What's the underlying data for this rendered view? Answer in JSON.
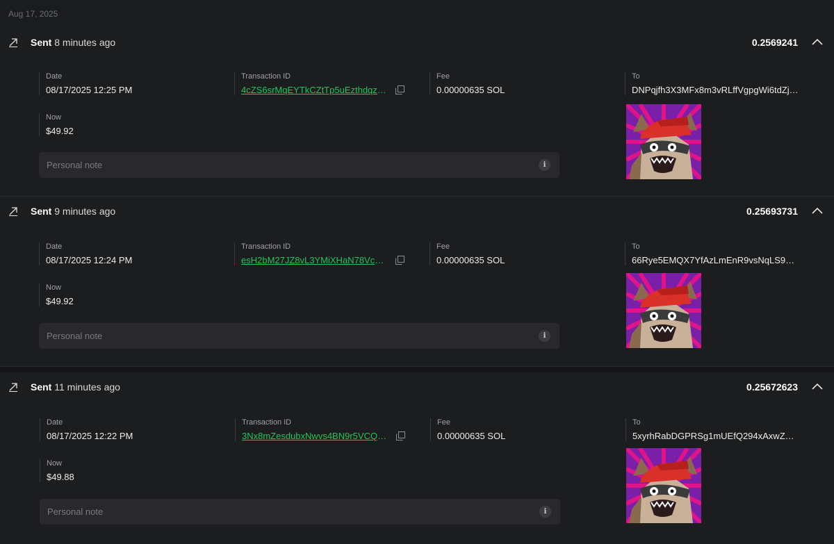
{
  "date_header": "Aug 17, 2025",
  "transactions": [
    {
      "status": "Sent",
      "time_ago": "8 minutes ago",
      "amount": "0.2569241",
      "date_label": "Date",
      "date_value": "08/17/2025 12:25 PM",
      "txid_label": "Transaction ID",
      "txid_value": "4cZS6srMqEYTkCZtTp5uEzthdqzxk…",
      "fee_label": "Fee",
      "fee_value": "0.00000635 SOL",
      "to_label": "To",
      "to_value": "DNPqjfh3X3MFx8m3vRLffVgpgWi6tdZj6…",
      "now_label": "Now",
      "now_value": "$49.92",
      "note_placeholder": "Personal note"
    },
    {
      "status": "Sent",
      "time_ago": "9 minutes ago",
      "amount": "0.25693731",
      "date_label": "Date",
      "date_value": "08/17/2025 12:24 PM",
      "txid_label": "Transaction ID",
      "txid_value": "esH2bM27JZ8vL3YMiXHaN78VcCf1…",
      "fee_label": "Fee",
      "fee_value": "0.00000635 SOL",
      "to_label": "To",
      "to_value": "66Rye5EMQX7YfAzLmEnR9vsNqLS9QT…",
      "now_label": "Now",
      "now_value": "$49.92",
      "note_placeholder": "Personal note"
    },
    {
      "status": "Sent",
      "time_ago": "11 minutes ago",
      "amount": "0.25672623",
      "date_label": "Date",
      "date_value": "08/17/2025 12:22 PM",
      "txid_label": "Transaction ID",
      "txid_value": "3Nx8mZesdubxNwvs4BN9r5VCQ7b…",
      "fee_label": "Fee",
      "fee_value": "0.00000635 SOL",
      "to_label": "To",
      "to_value": "5xyrhRabDGPRSg1mUEfQ294xAxwZw6…",
      "now_label": "Now",
      "now_value": "$49.88",
      "note_placeholder": "Personal note"
    }
  ],
  "icons": {
    "sent": "arrow-up-right-icon",
    "collapse": "chevron-up-icon",
    "copy": "copy-icon",
    "info": "info-icon",
    "nft": "raccoon-nft-image"
  },
  "colors": {
    "link": "#22c55e",
    "background": "#161618",
    "card": "#1c1d1f"
  }
}
